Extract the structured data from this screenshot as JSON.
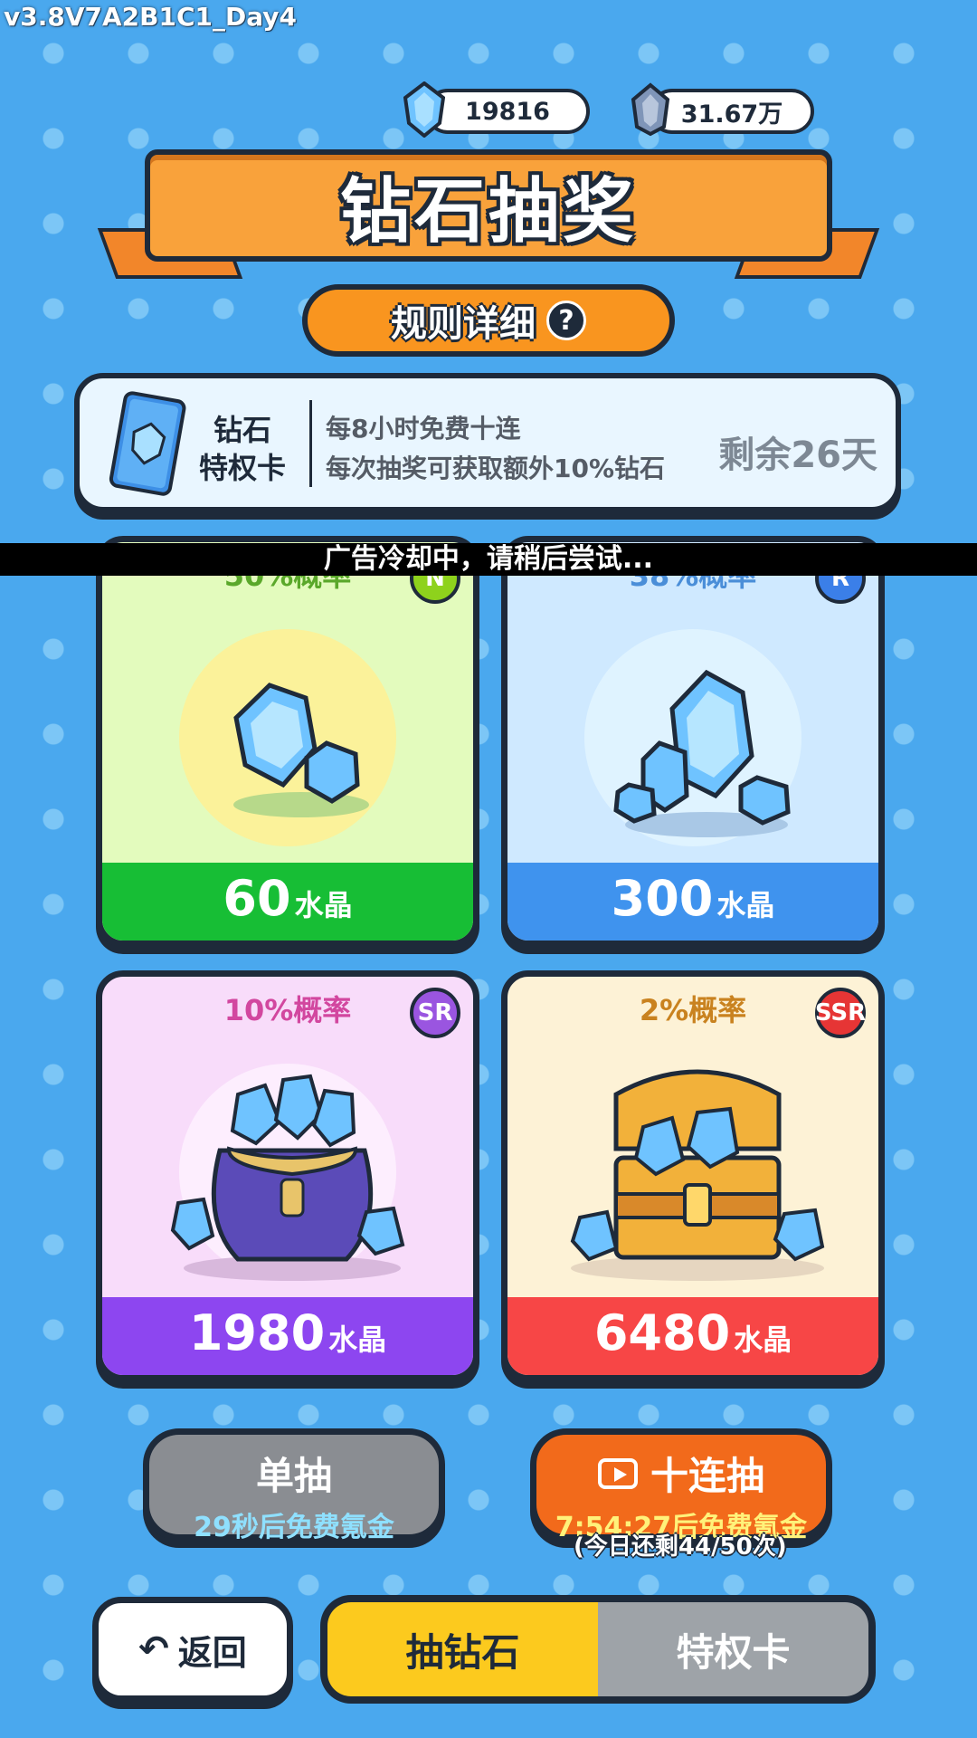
{
  "version": "v3.8V7A2B1C1_Day4",
  "currency": {
    "gems": "19816",
    "crystals": "31.67万",
    "gem_icon": "blue-gem-icon",
    "crystal_icon": "crystal-cluster-icon"
  },
  "banner": {
    "title": "钻石抽奖"
  },
  "rules_button": {
    "label": "规则详细",
    "icon": "?"
  },
  "privilege": {
    "title_line1": "钻石",
    "title_line2": "特权卡",
    "desc_line1": "每8小时免费十连",
    "desc_line2": "每次抽奖可获取额外10%钻石",
    "remaining": "剩余26天"
  },
  "toast": "广告冷却中，请稍后尝试...",
  "cards": [
    {
      "probability": "50%概率",
      "rarity": "N",
      "amount": "60",
      "unit": "水晶",
      "colors": {
        "bg": "#e3fbbd",
        "bottom": "#17be35",
        "prob": "#5aa82a",
        "badge": "#8ed21c"
      }
    },
    {
      "probability": "38%概率",
      "rarity": "R",
      "amount": "300",
      "unit": "水晶",
      "colors": {
        "bg": "#cfe9ff",
        "bottom": "#3f93ee",
        "prob": "#4a8ed8",
        "badge": "#3b7fe8"
      }
    },
    {
      "probability": "10%概率",
      "rarity": "SR",
      "amount": "1980",
      "unit": "水晶",
      "colors": {
        "bg": "#f8dcfa",
        "bottom": "#8d46f0",
        "prob": "#d2479f",
        "badge": "#9a55e0"
      }
    },
    {
      "probability": "2%概率",
      "rarity": "SSR",
      "amount": "6480",
      "unit": "水晶",
      "colors": {
        "bg": "#fdf2d6",
        "bottom": "#f74646",
        "prob": "#c9821f",
        "badge": "#e63535"
      }
    }
  ],
  "single_draw": {
    "label": "单抽",
    "timer": "29秒后免费氪金"
  },
  "ten_draw": {
    "label": "十连抽",
    "timer": "7:54:27后免费氪金",
    "remaining": "(今日还剩44/50次)",
    "icon": "video-icon"
  },
  "back_button": {
    "label": "返回",
    "icon": "↶"
  },
  "tabs": [
    {
      "label": "抽钻石",
      "active": true
    },
    {
      "label": "特权卡",
      "active": false
    }
  ]
}
